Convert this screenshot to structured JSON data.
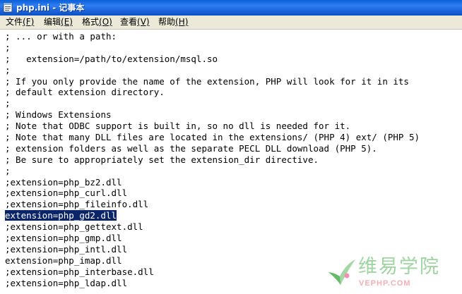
{
  "window": {
    "title": "php.ini - 记事本"
  },
  "menu": [
    {
      "label": "文件",
      "accel": "(F)"
    },
    {
      "label": "编辑",
      "accel": "(E)"
    },
    {
      "label": "格式",
      "accel": "(O)"
    },
    {
      "label": "查看",
      "accel": "(V)"
    },
    {
      "label": "帮助",
      "accel": "(H)"
    }
  ],
  "editor": {
    "lines": [
      "; ... or with a path:",
      ";",
      ";   extension=/path/to/extension/msql.so",
      ";",
      "; If you only provide the name of the extension, PHP will look for it in its",
      "; default extension directory.",
      ";",
      "; Windows Extensions",
      "; Note that ODBC support is built in, so no dll is needed for it.",
      "; Note that many DLL files are located in the extensions/ (PHP 4) ext/ (PHP 5)",
      "; extension folders as well as the separate PECL DLL download (PHP 5).",
      "; Be sure to appropriately set the extension_dir directive.",
      ";",
      ";extension=php_bz2.dll",
      ";extension=php_curl.dll",
      ";extension=php_fileinfo.dll",
      "extension=php_gd2.dll",
      ";extension=php_gettext.dll",
      ";extension=php_gmp.dll",
      ";extension=php_intl.dll",
      "extension=php_imap.dll",
      ";extension=php_interbase.dll",
      ";extension=php_ldap.dll"
    ],
    "selected_line_index": 16
  },
  "watermark": {
    "chinese": "维易学院",
    "english": "VEPHP.COM"
  },
  "colors": {
    "titlebar": "#1c63dc",
    "menubar": "#ece9d8",
    "selection": "#0a246a",
    "watermark_green": "#9fd3a2",
    "watermark_pink": "#f0b0b6"
  }
}
